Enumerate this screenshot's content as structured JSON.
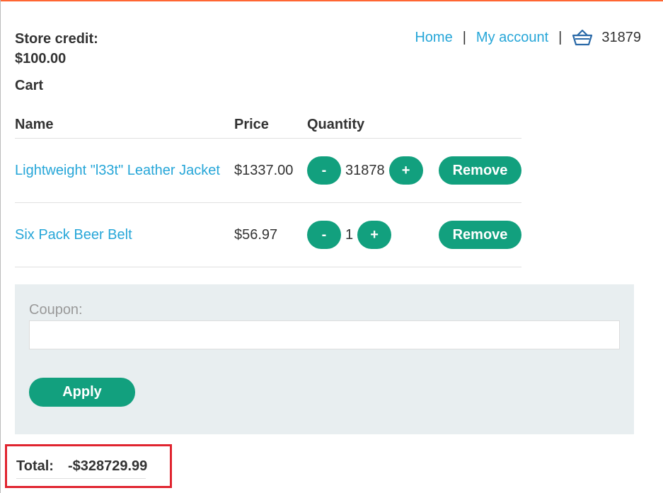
{
  "store_credit": {
    "label": "Store credit:",
    "value": "$100.00"
  },
  "nav": {
    "home": "Home",
    "separator": "|",
    "my_account": "My account",
    "cart_icon": "basket-icon",
    "cart_count": "31879"
  },
  "cart": {
    "heading": "Cart",
    "columns": {
      "name": "Name",
      "price": "Price",
      "quantity": "Quantity"
    },
    "items": [
      {
        "name": "Lightweight \"l33t\" Leather Jacket",
        "price": "$1337.00",
        "quantity": "31878",
        "minus": "-",
        "plus": "+",
        "remove": "Remove"
      },
      {
        "name": "Six Pack Beer Belt",
        "price": "$56.97",
        "quantity": "1",
        "minus": "-",
        "plus": "+",
        "remove": "Remove"
      }
    ]
  },
  "coupon": {
    "label": "Coupon:",
    "value": "",
    "apply": "Apply"
  },
  "total": {
    "label": "Total:",
    "amount": "-$328729.99"
  },
  "colors": {
    "accent_top": "#ff6633",
    "link": "#26a6d8",
    "button": "#12a07e",
    "coupon_bg": "#e8eef0",
    "highlight_box": "#e0242f"
  }
}
